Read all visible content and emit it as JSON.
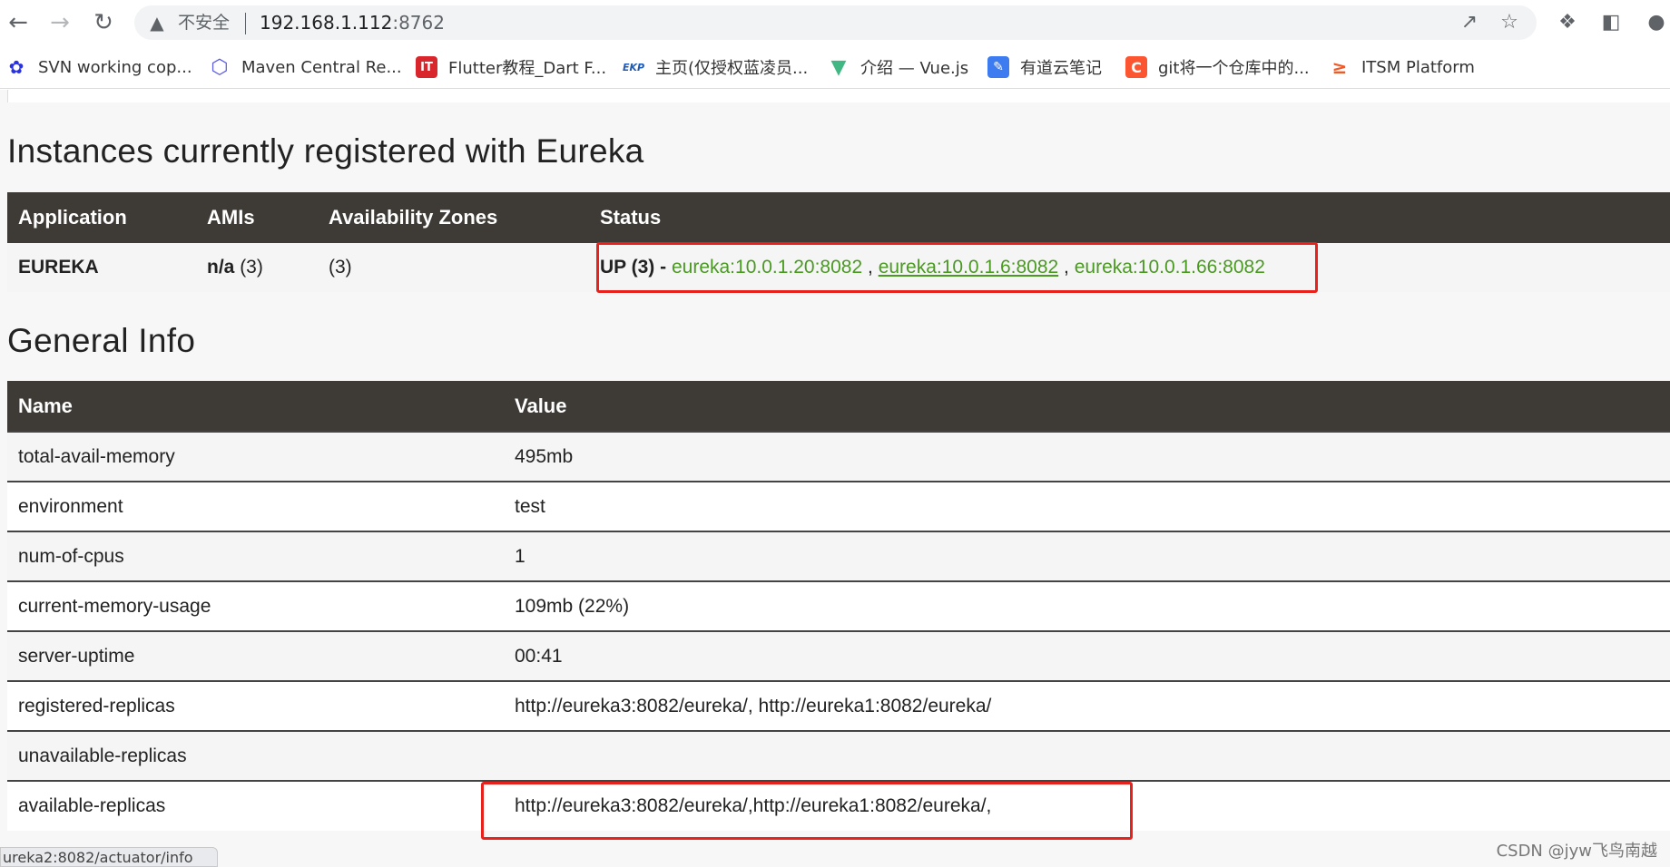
{
  "browser": {
    "insecure_label": "不安全",
    "url_host": "192.168.1.112",
    "url_port": ":8762",
    "bookmarks": [
      {
        "label": "SVN working cop...",
        "icon": "baidu-icon"
      },
      {
        "label": "Maven Central Re...",
        "icon": "hexagon-icon"
      },
      {
        "label": "Flutter教程_Dart F...",
        "icon": "it-logo-icon"
      },
      {
        "label": "主页(仅授权蓝凌员...",
        "icon": "ekp-icon"
      },
      {
        "label": "介绍 — Vue.js",
        "icon": "vue-icon"
      },
      {
        "label": "有道云笔记",
        "icon": "youdao-icon"
      },
      {
        "label": "git将一个仓库中的...",
        "icon": "csdn-icon"
      },
      {
        "label": "ITSM Platform",
        "icon": "itsm-icon"
      }
    ]
  },
  "instances": {
    "heading": "Instances currently registered with Eureka",
    "columns": [
      "Application",
      "AMIs",
      "Availability Zones",
      "Status"
    ],
    "row": {
      "application": "EUREKA",
      "amis_value": "n/a",
      "amis_count": "(3)",
      "zones": "(3)",
      "status_prefix": "UP (3) -",
      "links": [
        "eureka:10.0.1.20:8082",
        "eureka:10.0.1.6:8082",
        "eureka:10.0.1.66:8082"
      ],
      "separator": ","
    }
  },
  "general": {
    "heading": "General Info",
    "columns": [
      "Name",
      "Value"
    ],
    "rows": [
      {
        "name": "total-avail-memory",
        "value": "495mb"
      },
      {
        "name": "environment",
        "value": "test"
      },
      {
        "name": "num-of-cpus",
        "value": "1"
      },
      {
        "name": "current-memory-usage",
        "value": "109mb (22%)"
      },
      {
        "name": "server-uptime",
        "value": "00:41"
      },
      {
        "name": "registered-replicas",
        "value": "http://eureka3:8082/eureka/, http://eureka1:8082/eureka/"
      },
      {
        "name": "unavailable-replicas",
        "value": ""
      },
      {
        "name": "available-replicas",
        "value": "http://eureka3:8082/eureka/,http://eureka1:8082/eureka/,"
      }
    ]
  },
  "status_bar": "ureka2:8082/actuator/info",
  "watermark": "CSDN @jyw飞鸟南越",
  "colors": {
    "header_bg": "#3e3a36",
    "link_green": "#4a9a22",
    "highlight_red": "#e8211c"
  }
}
